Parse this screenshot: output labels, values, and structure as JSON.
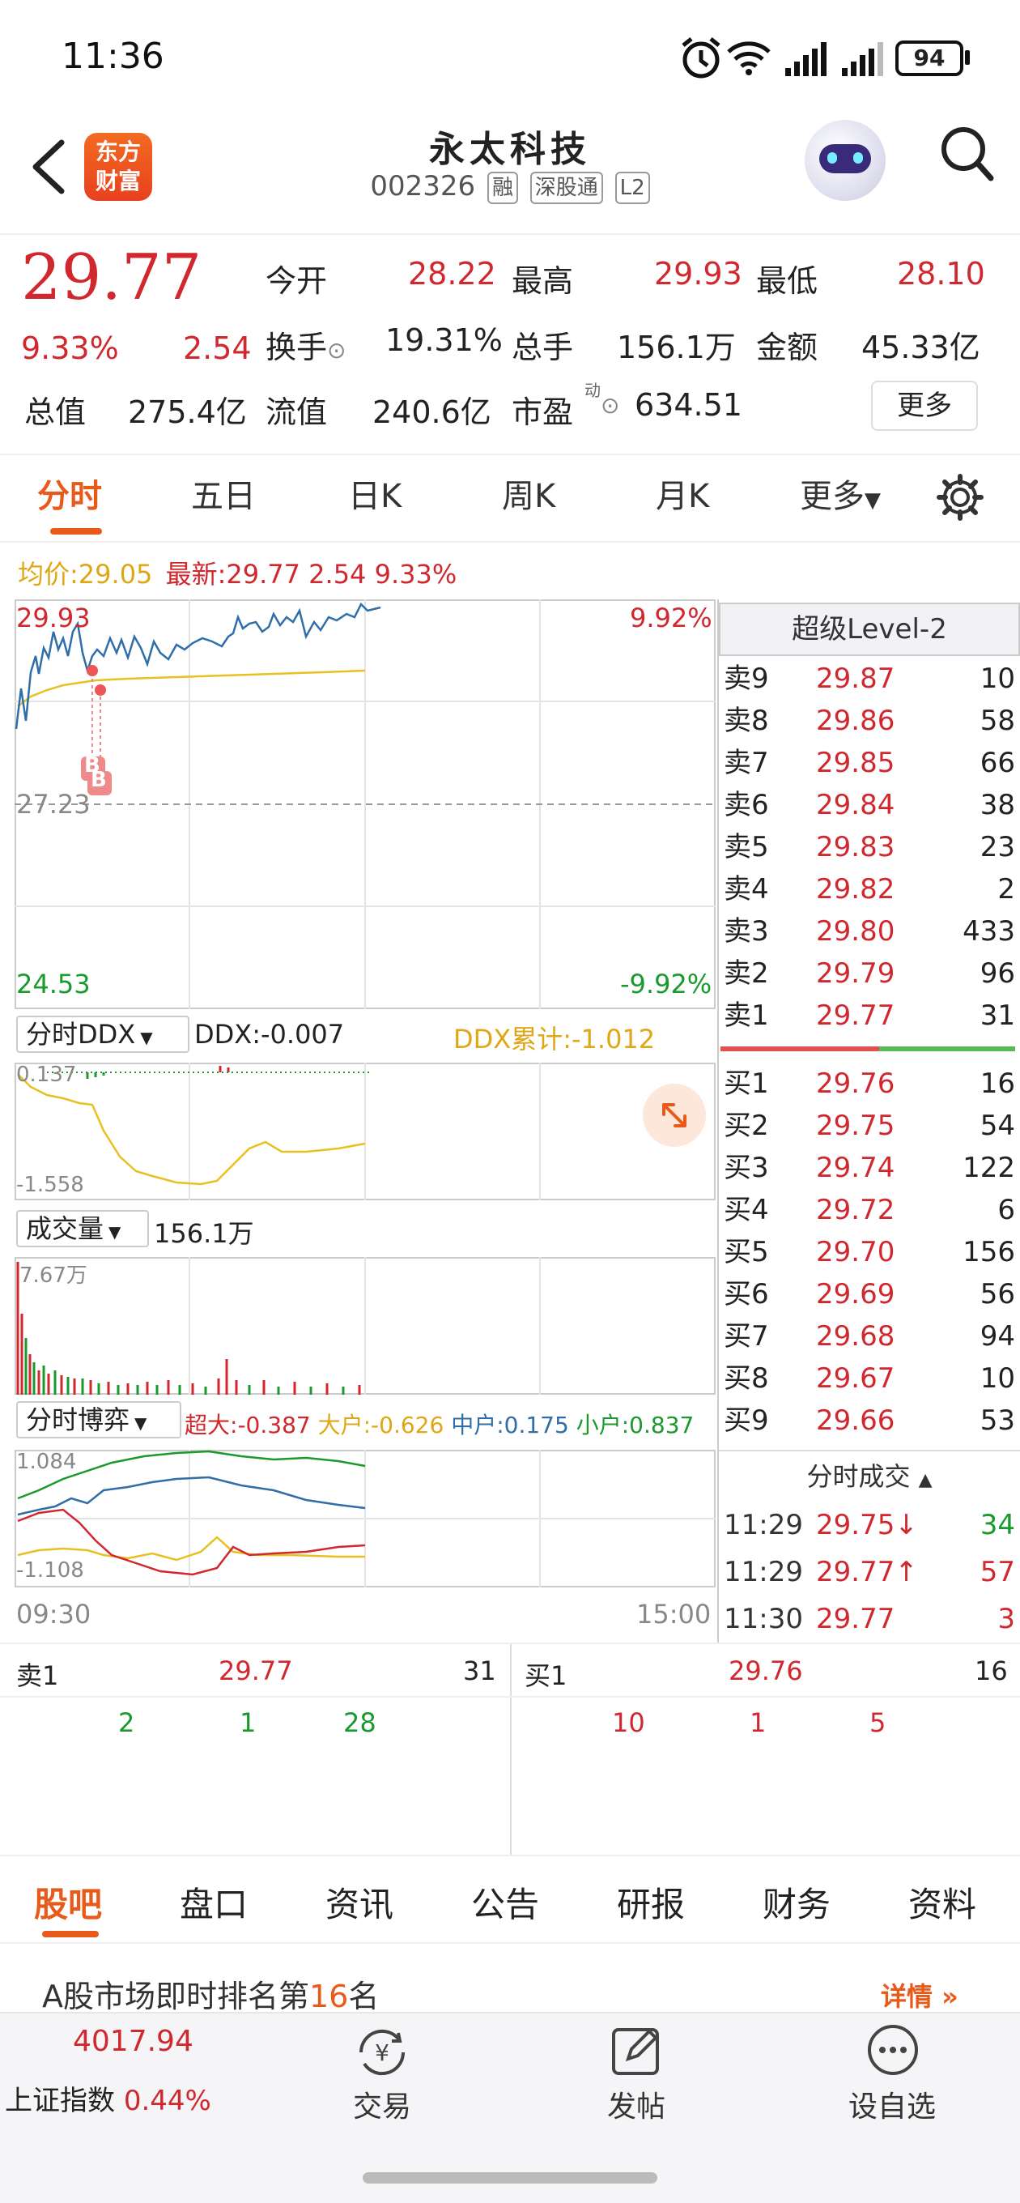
{
  "status_bar": {
    "time": "11:36",
    "battery": "94",
    "icons": [
      "alarm-icon",
      "wifi-icon",
      "signal-icon",
      "signal-icon",
      "battery-icon"
    ]
  },
  "header": {
    "logo_line1": "东方",
    "logo_line2": "财富",
    "stock_name": "永太科技",
    "stock_code": "002326",
    "tags": [
      "融",
      "深股通",
      "L2"
    ]
  },
  "quote": {
    "price": "29.77",
    "change_pct": "9.33%",
    "change": "2.54",
    "open_label": "今开",
    "open": "28.22",
    "high_label": "最高",
    "high": "29.93",
    "low_label": "最低",
    "low": "28.10",
    "turnover_label": "换手",
    "turnover": "19.31%",
    "volume_label": "总手",
    "volume": "156.1万",
    "amount_label": "金额",
    "amount": "45.33亿",
    "mktcap_label": "总值",
    "mktcap": "275.4亿",
    "float_label": "流值",
    "float_cap": "240.6亿",
    "pe_label": "市盈",
    "pe_sup": "动",
    "pe": "634.51",
    "more_label": "更多"
  },
  "chart_tabs": [
    "分时",
    "五日",
    "日K",
    "周K",
    "月K",
    "更多"
  ],
  "intraday": {
    "avg_label": "均价:",
    "avg": "29.05",
    "latest_label": "最新:",
    "latest": "29.77 2.54 9.33%",
    "y_top": "29.93",
    "y_mid": "27.23",
    "y_bottom": "24.53",
    "pct_top": "9.92%",
    "pct_bottom": "-9.92%",
    "marker": "B",
    "time_start": "09:30",
    "time_end": "15:00"
  },
  "ddx": {
    "selector": "分时DDX",
    "ddx_label": "DDX:-0.007",
    "cum_label": "DDX累计:-1.012",
    "y_top": "0.137",
    "y_bottom": "-1.558"
  },
  "volume": {
    "selector": "成交量",
    "value": "156.1万",
    "y_top": "7.67万"
  },
  "game": {
    "selector": "分时博弈",
    "super_label": "超大:",
    "super": "-0.387",
    "big_label": "大户:",
    "big": "-0.626",
    "mid_label": "中户:",
    "mid": "0.175",
    "small_label": "小户:",
    "small": "0.837",
    "y_top": "1.084",
    "y_bottom": "-1.108"
  },
  "orderbook": {
    "title": "超级Level-2",
    "asks": [
      {
        "label": "卖9",
        "price": "29.87",
        "vol": "10"
      },
      {
        "label": "卖8",
        "price": "29.86",
        "vol": "58"
      },
      {
        "label": "卖7",
        "price": "29.85",
        "vol": "66"
      },
      {
        "label": "卖6",
        "price": "29.84",
        "vol": "38"
      },
      {
        "label": "卖5",
        "price": "29.83",
        "vol": "23"
      },
      {
        "label": "卖4",
        "price": "29.82",
        "vol": "2"
      },
      {
        "label": "卖3",
        "price": "29.80",
        "vol": "433"
      },
      {
        "label": "卖2",
        "price": "29.79",
        "vol": "96"
      },
      {
        "label": "卖1",
        "price": "29.77",
        "vol": "31"
      }
    ],
    "bids": [
      {
        "label": "买1",
        "price": "29.76",
        "vol": "16"
      },
      {
        "label": "买2",
        "price": "29.75",
        "vol": "54"
      },
      {
        "label": "买3",
        "price": "29.74",
        "vol": "122"
      },
      {
        "label": "买4",
        "price": "29.72",
        "vol": "6"
      },
      {
        "label": "买5",
        "price": "29.70",
        "vol": "156"
      },
      {
        "label": "买6",
        "price": "29.69",
        "vol": "56"
      },
      {
        "label": "买7",
        "price": "29.68",
        "vol": "94"
      },
      {
        "label": "买8",
        "price": "29.67",
        "vol": "10"
      },
      {
        "label": "买9",
        "price": "29.66",
        "vol": "53"
      }
    ],
    "ticks_title": "分时成交",
    "ticks": [
      {
        "time": "11:29",
        "price": "29.75↓",
        "vol": "34"
      },
      {
        "time": "11:29",
        "price": "29.77↑",
        "vol": "57"
      },
      {
        "time": "11:30",
        "price": "29.77",
        "vol": "3"
      }
    ]
  },
  "queue": {
    "ask_label": "卖1",
    "ask_price": "29.77",
    "ask_vol": "31",
    "ask_orders": [
      "2",
      "1",
      "28"
    ],
    "bid_label": "买1",
    "bid_price": "29.76",
    "bid_vol": "16",
    "bid_orders": [
      "10",
      "1",
      "5"
    ]
  },
  "bottom_tabs": [
    "股吧",
    "盘口",
    "资讯",
    "公告",
    "研报",
    "财务",
    "资料"
  ],
  "ranking": {
    "prefix": "A股市场即时排名第",
    "rank": "16",
    "suffix": "名",
    "detail": "详情"
  },
  "nav": {
    "index_value": "4017.94",
    "index_name": "上证指数",
    "index_pct": "0.44%",
    "trade": "交易",
    "post": "发帖",
    "watch": "设自选"
  }
}
